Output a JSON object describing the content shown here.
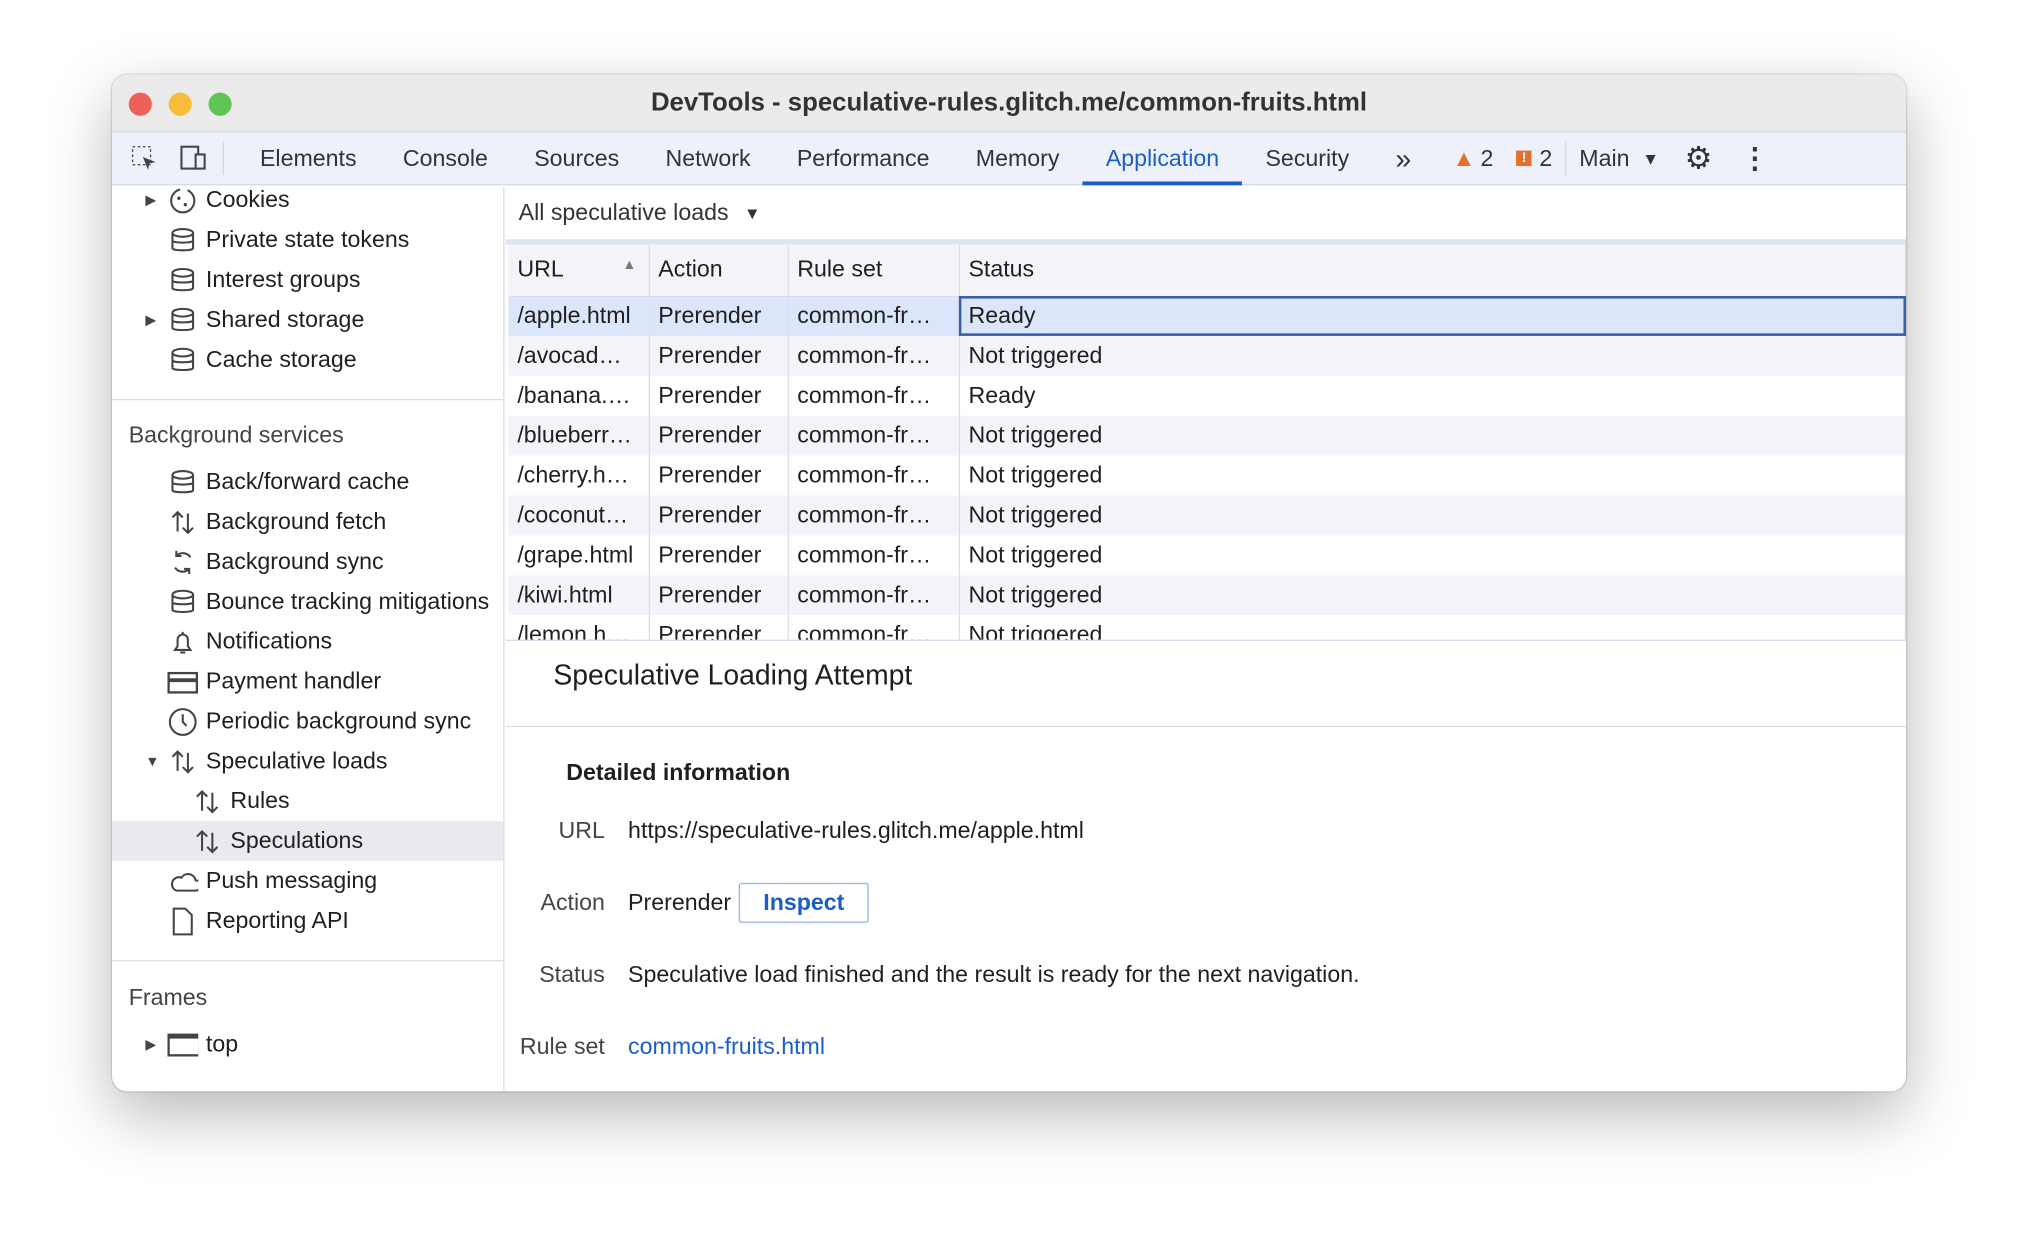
{
  "window": {
    "title": "DevTools - speculative-rules.glitch.me/common-fruits.html",
    "traffic_lights": [
      "#ee5f57",
      "#f6bd3b",
      "#5fc451"
    ]
  },
  "toolbar": {
    "tabs": [
      "Elements",
      "Console",
      "Sources",
      "Network",
      "Performance",
      "Memory",
      "Application",
      "Security"
    ],
    "active_tab": "Application",
    "more": "»",
    "warnings": "2",
    "issues": "2",
    "context": "Main"
  },
  "sidebar": {
    "storage_items": [
      {
        "label": "Cookies",
        "icon": "cookie-icon",
        "expandable": true
      },
      {
        "label": "Private state tokens",
        "icon": "database-icon"
      },
      {
        "label": "Interest groups",
        "icon": "database-icon"
      },
      {
        "label": "Shared storage",
        "icon": "database-icon",
        "expandable": true
      },
      {
        "label": "Cache storage",
        "icon": "database-icon"
      }
    ],
    "background_header": "Background services",
    "background_items": [
      {
        "label": "Back/forward cache",
        "icon": "database-icon"
      },
      {
        "label": "Background fetch",
        "icon": "arrows-updown-icon"
      },
      {
        "label": "Background sync",
        "icon": "sync-icon"
      },
      {
        "label": "Bounce tracking mitigations",
        "icon": "database-icon"
      },
      {
        "label": "Notifications",
        "icon": "bell-icon"
      },
      {
        "label": "Payment handler",
        "icon": "card-icon"
      },
      {
        "label": "Periodic background sync",
        "icon": "clock-icon"
      },
      {
        "label": "Speculative loads",
        "icon": "arrows-updown-icon"
      },
      {
        "label": "Rules",
        "icon": "arrows-updown-icon"
      },
      {
        "label": "Speculations",
        "icon": "arrows-updown-icon"
      },
      {
        "label": "Push messaging",
        "icon": "cloud-icon"
      },
      {
        "label": "Reporting API",
        "icon": "file-icon"
      }
    ],
    "frames_header": "Frames",
    "frames_items": [
      {
        "label": "top",
        "icon": "frame-icon"
      }
    ]
  },
  "filter": {
    "label": "All speculative loads"
  },
  "table": {
    "headers": [
      "URL",
      "Action",
      "Rule set",
      "Status"
    ],
    "rows": [
      [
        "/apple.html",
        "Prerender",
        "common-fr…",
        "Ready"
      ],
      [
        "/avocad…",
        "Prerender",
        "common-fr…",
        "Not triggered"
      ],
      [
        "/banana.…",
        "Prerender",
        "common-fr…",
        "Ready"
      ],
      [
        "/blueberr…",
        "Prerender",
        "common-fr…",
        "Not triggered"
      ],
      [
        "/cherry.h…",
        "Prerender",
        "common-fr…",
        "Not triggered"
      ],
      [
        "/coconut…",
        "Prerender",
        "common-fr…",
        "Not triggered"
      ],
      [
        "/grape.html",
        "Prerender",
        "common-fr…",
        "Not triggered"
      ],
      [
        "/kiwi.html",
        "Prerender",
        "common-fr…",
        "Not triggered"
      ],
      [
        "/lemon.h…",
        "Prerender",
        "common-fr…",
        "Not triggered"
      ]
    ]
  },
  "detail": {
    "title": "Speculative Loading Attempt",
    "section": "Detailed information",
    "url_label": "URL",
    "url": "https://speculative-rules.glitch.me/apple.html",
    "action_label": "Action",
    "action": "Prerender",
    "inspect": "Inspect",
    "status_label": "Status",
    "status": "Speculative load finished and the result is ready for the next navigation.",
    "ruleset_label": "Rule set",
    "ruleset": "common-fruits.html"
  }
}
